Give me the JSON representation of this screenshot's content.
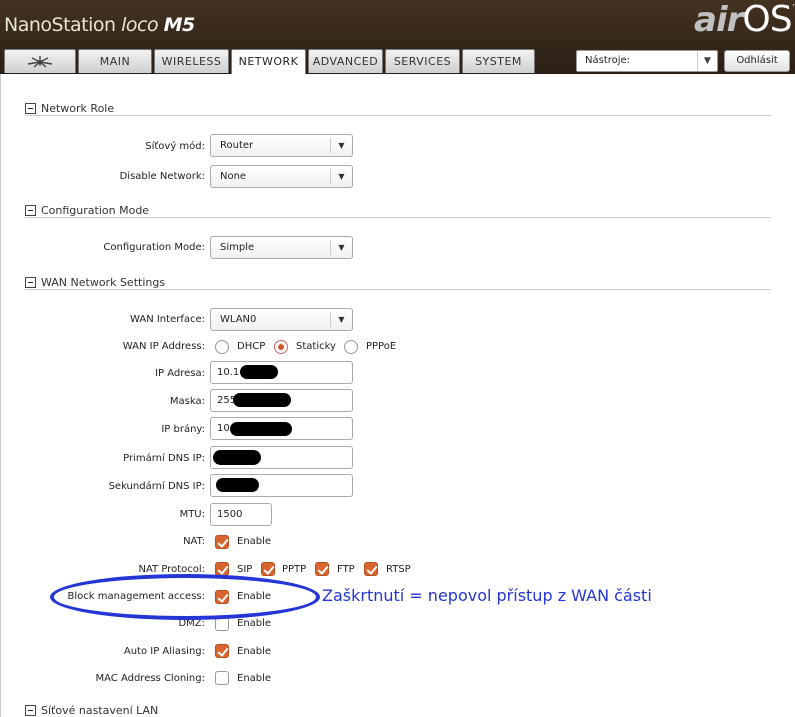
{
  "header": {
    "brand_main": "NanoStation ",
    "brand_loco": "loco ",
    "brand_model": "M5",
    "logo_air": "air",
    "logo_os": "OS",
    "logo_tm": "™",
    "tabs": [
      "MAIN",
      "WIRELESS",
      "NETWORK",
      "ADVANCED",
      "SERVICES",
      "SYSTEM"
    ],
    "tools_label": "Nástroje:",
    "logout_label": "Odhlásit"
  },
  "network_role": {
    "title": "Network Role",
    "mode_label": "Síťový mód:",
    "mode_value": "Router",
    "disable_label": "Disable Network:",
    "disable_value": "None"
  },
  "config_mode": {
    "title": "Configuration Mode",
    "label": "Configuration Mode:",
    "value": "Simple"
  },
  "wan": {
    "title": "WAN Network Settings",
    "interface_label": "WAN Interface:",
    "interface_value": "WLAN0",
    "ip_address_label": "WAN IP Address:",
    "ip_options": [
      "DHCP",
      "Staticky",
      "PPPoE"
    ],
    "ip_selected": "Staticky",
    "ip_label": "IP Adresa:",
    "ip_value": "10.1",
    "mask_label": "Maska:",
    "mask_value": "255",
    "gateway_label": "IP brány:",
    "gateway_value": "10.",
    "dns1_label": "Primární DNS IP:",
    "dns2_label": "Sekundární DNS IP:",
    "mtu_label": "MTU:",
    "mtu_value": "1500",
    "nat_label": "NAT:",
    "nat_enable": "Enable",
    "nat_protocol_label": "NAT Protocol:",
    "nat_protocols": [
      "SIP",
      "PPTP",
      "FTP",
      "RTSP"
    ],
    "block_label": "Block management access:",
    "block_enable": "Enable",
    "dmz_label": "DMZ:",
    "dmz_enable": "Enable",
    "alias_label": "Auto IP Aliasing:",
    "alias_enable": "Enable",
    "mac_label": "MAC Address Cloning:",
    "mac_enable": "Enable"
  },
  "lan": {
    "title": "Síťové nastavení LAN"
  },
  "annotation": {
    "text": "Zaškrtnutí = nepovol přístup z WAN části",
    "color": "#2436d6"
  },
  "colors": {
    "accent": "#d8652f",
    "header": "#3a2b1d"
  }
}
